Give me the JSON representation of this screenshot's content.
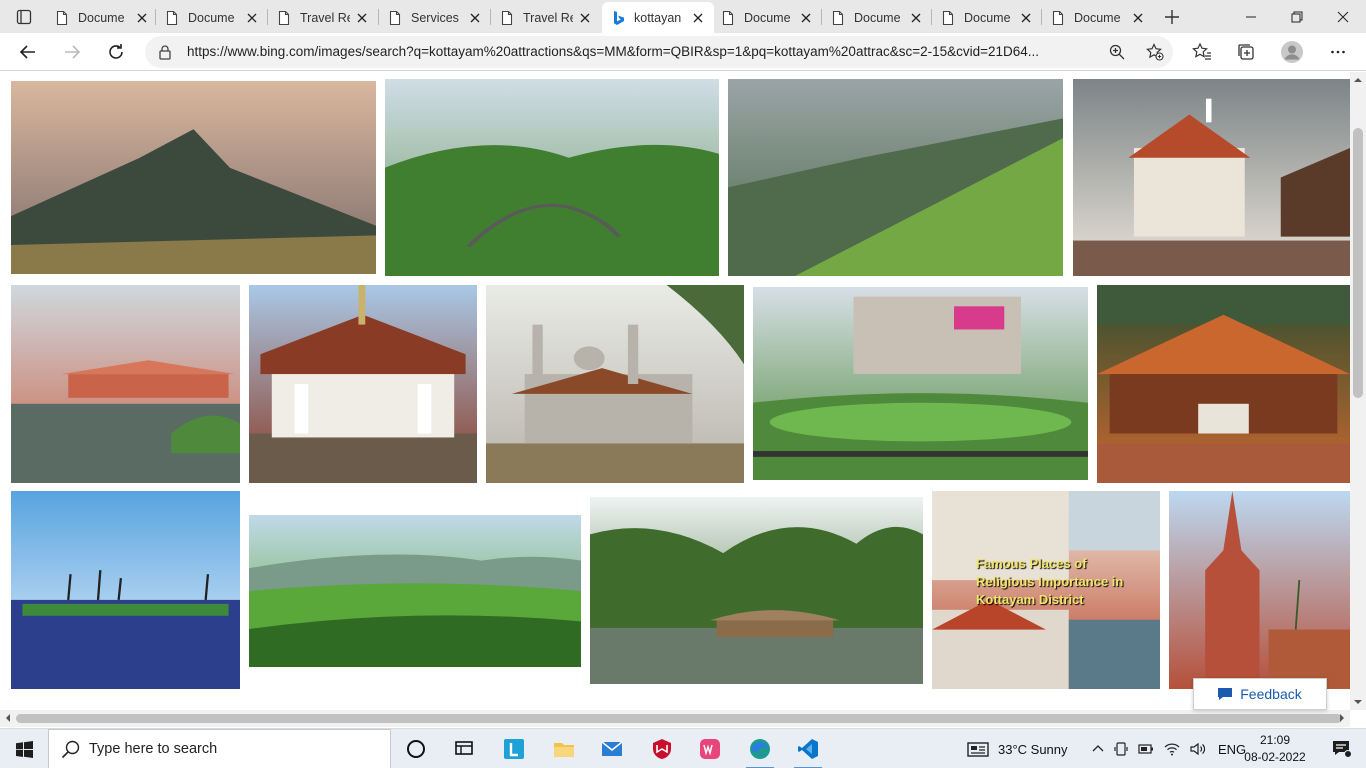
{
  "browser": {
    "tabs": [
      {
        "title": "Docume",
        "icon": "document-icon",
        "active": false
      },
      {
        "title": "Docume",
        "icon": "document-icon",
        "active": false
      },
      {
        "title": "Travel Re",
        "icon": "document-icon",
        "active": false
      },
      {
        "title": "Services",
        "icon": "document-icon",
        "active": false
      },
      {
        "title": "Travel Re",
        "icon": "document-icon",
        "active": false
      },
      {
        "title": "kottayan",
        "icon": "bing-icon",
        "active": true
      },
      {
        "title": "Docume",
        "icon": "document-icon",
        "active": false
      },
      {
        "title": "Docume",
        "icon": "document-icon",
        "active": false
      },
      {
        "title": "Docume",
        "icon": "document-icon",
        "active": false
      },
      {
        "title": "Docume",
        "icon": "document-icon",
        "active": false
      }
    ],
    "url": "https://www.bing.com/images/search?q=kottayam%20attractions&qs=MM&form=QBIR&sp=1&pq=kottayam%20attrac&sc=2-15&cvid=21D64..."
  },
  "gallery": {
    "images": [
      {
        "name": "mountain-peak",
        "colors": [
          "#d9b79e",
          "#7b6b6a",
          "#3c4a3e"
        ]
      },
      {
        "name": "green-hills-road",
        "colors": [
          "#cfdde6",
          "#6f9a62",
          "#3f7f2f"
        ]
      },
      {
        "name": "misty-green-slope",
        "colors": [
          "#9aa4a6",
          "#4f6b4c",
          "#74a844"
        ]
      },
      {
        "name": "white-church",
        "colors": [
          "#7d8487",
          "#eae4d9",
          "#b54b2a"
        ]
      },
      {
        "name": "boat-jetty",
        "colors": [
          "#cfd8de",
          "#c9644a",
          "#5a6b63"
        ]
      },
      {
        "name": "temple-gateway",
        "colors": [
          "#a9c8e6",
          "#8a3b26",
          "#f0ede6"
        ]
      },
      {
        "name": "mosque",
        "colors": [
          "#e9ebe6",
          "#b7b3aa",
          "#6d5b4a"
        ]
      },
      {
        "name": "town-garden",
        "colors": [
          "#d7dfe6",
          "#4f8a3c",
          "#3b5a2f"
        ]
      },
      {
        "name": "heritage-pavilion",
        "colors": [
          "#2f4f2f",
          "#c9672f",
          "#7a3a20"
        ]
      },
      {
        "name": "lake-palms",
        "colors": [
          "#58a3e0",
          "#e9f2fa",
          "#2c3f8c"
        ]
      },
      {
        "name": "tea-plantation",
        "colors": [
          "#c2d9e8",
          "#5aa83a",
          "#2f6b22"
        ]
      },
      {
        "name": "backwater-houseboat",
        "colors": [
          "#eef3f3",
          "#3f6b2c",
          "#8a6b4a"
        ]
      },
      {
        "name": "religious-places-collage",
        "colors": [
          "#f0e9dd",
          "#b8442a",
          "#5a7a8a"
        ]
      },
      {
        "name": "gothic-church",
        "colors": [
          "#bcd8f0",
          "#b6503a",
          "#eae3d8"
        ]
      }
    ],
    "collage_caption": "Famous Places of Religious Importance in Kottayam District",
    "feedback_label": "Feedback"
  },
  "taskbar": {
    "search_placeholder": "Type here to search",
    "apps": [
      "task-view-icon",
      "widgets-icon",
      "l-app-icon",
      "file-explorer-icon",
      "mail-icon",
      "mcafee-icon",
      "wps-icon",
      "edge-icon",
      "vscode-icon"
    ],
    "weather": "33°C  Sunny",
    "language": "ENG",
    "time": "21:09",
    "date": "08-02-2022"
  }
}
